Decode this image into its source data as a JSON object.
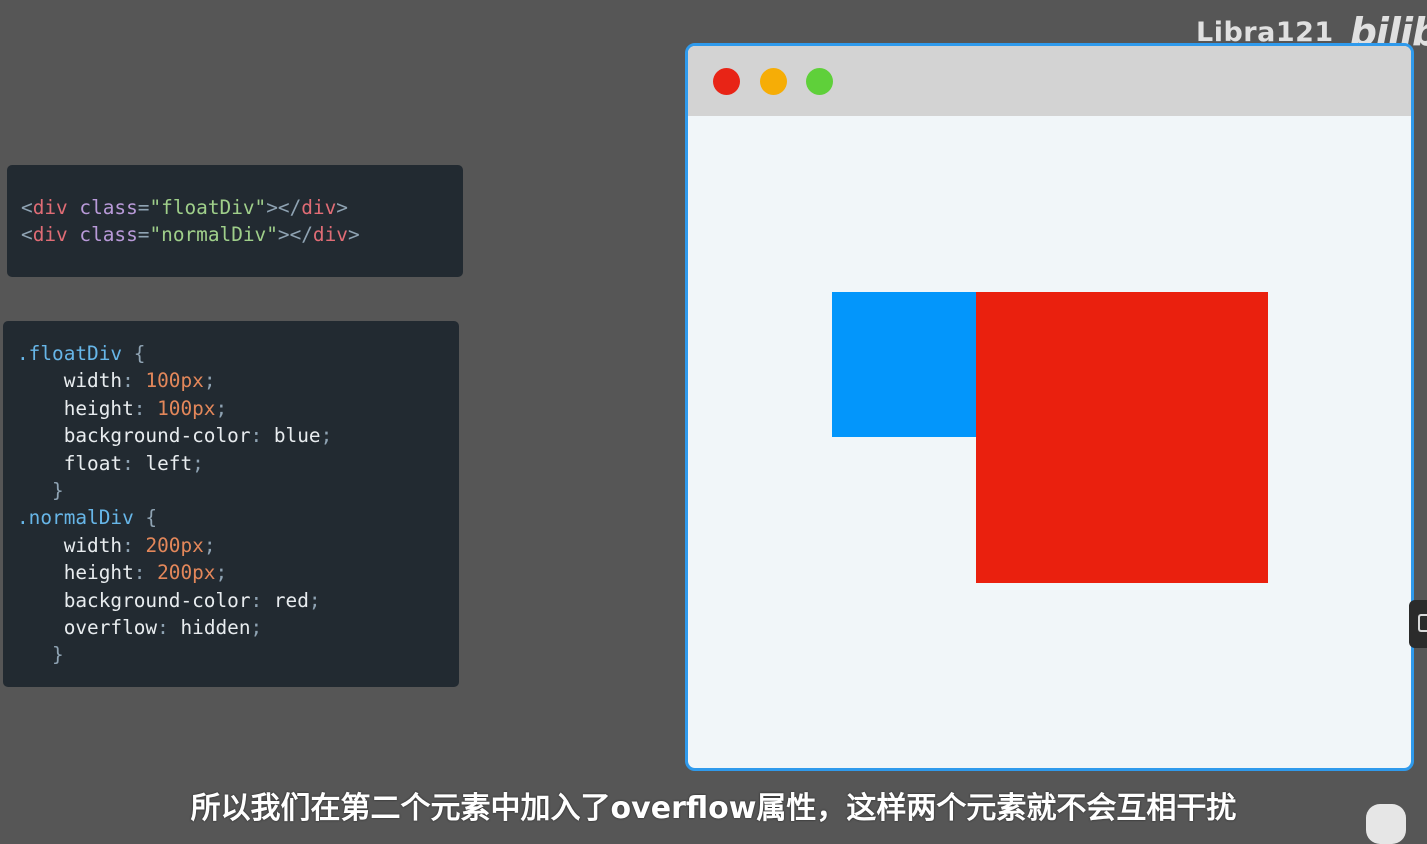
{
  "watermark": {
    "user": "Libra121",
    "logo": "bilib"
  },
  "html_code": {
    "lines": [
      [
        {
          "t": "punc",
          "v": "<"
        },
        {
          "t": "tag",
          "v": "div"
        },
        {
          "t": "punc",
          "v": " "
        },
        {
          "t": "attr",
          "v": "class"
        },
        {
          "t": "punc",
          "v": "="
        },
        {
          "t": "str",
          "v": "\"floatDiv\""
        },
        {
          "t": "punc",
          "v": "></"
        },
        {
          "t": "tag",
          "v": "div"
        },
        {
          "t": "punc",
          "v": ">"
        }
      ],
      [
        {
          "t": "punc",
          "v": "<"
        },
        {
          "t": "tag",
          "v": "div"
        },
        {
          "t": "punc",
          "v": " "
        },
        {
          "t": "attr",
          "v": "class"
        },
        {
          "t": "punc",
          "v": "="
        },
        {
          "t": "str",
          "v": "\"normalDiv\""
        },
        {
          "t": "punc",
          "v": "></"
        },
        {
          "t": "tag",
          "v": "div"
        },
        {
          "t": "punc",
          "v": ">"
        }
      ]
    ]
  },
  "css_code": {
    "lines": [
      [
        {
          "t": "sel",
          "v": ".floatDiv"
        },
        {
          "t": "punc",
          "v": " {"
        }
      ],
      [
        {
          "t": "punc",
          "v": "    "
        },
        {
          "t": "prop",
          "v": "width"
        },
        {
          "t": "punc",
          "v": ": "
        },
        {
          "t": "num",
          "v": "100px"
        },
        {
          "t": "punc",
          "v": ";"
        }
      ],
      [
        {
          "t": "punc",
          "v": "    "
        },
        {
          "t": "prop",
          "v": "height"
        },
        {
          "t": "punc",
          "v": ": "
        },
        {
          "t": "num",
          "v": "100px"
        },
        {
          "t": "punc",
          "v": ";"
        }
      ],
      [
        {
          "t": "punc",
          "v": "    "
        },
        {
          "t": "prop",
          "v": "background-color"
        },
        {
          "t": "punc",
          "v": ": "
        },
        {
          "t": "val",
          "v": "blue"
        },
        {
          "t": "punc",
          "v": ";"
        }
      ],
      [
        {
          "t": "punc",
          "v": "    "
        },
        {
          "t": "prop",
          "v": "float"
        },
        {
          "t": "punc",
          "v": ": "
        },
        {
          "t": "val",
          "v": "left"
        },
        {
          "t": "punc",
          "v": ";"
        }
      ],
      [
        {
          "t": "punc",
          "v": "   }"
        }
      ],
      [
        {
          "t": "sel",
          "v": ".normalDiv"
        },
        {
          "t": "punc",
          "v": " {"
        }
      ],
      [
        {
          "t": "punc",
          "v": "    "
        },
        {
          "t": "prop",
          "v": "width"
        },
        {
          "t": "punc",
          "v": ": "
        },
        {
          "t": "num",
          "v": "200px"
        },
        {
          "t": "punc",
          "v": ";"
        }
      ],
      [
        {
          "t": "punc",
          "v": "    "
        },
        {
          "t": "prop",
          "v": "height"
        },
        {
          "t": "punc",
          "v": ": "
        },
        {
          "t": "num",
          "v": "200px"
        },
        {
          "t": "punc",
          "v": ";"
        }
      ],
      [
        {
          "t": "punc",
          "v": "    "
        },
        {
          "t": "prop",
          "v": "background-color"
        },
        {
          "t": "punc",
          "v": ": "
        },
        {
          "t": "val",
          "v": "red"
        },
        {
          "t": "punc",
          "v": ";"
        }
      ],
      [
        {
          "t": "punc",
          "v": "    "
        },
        {
          "t": "prop",
          "v": "overflow"
        },
        {
          "t": "punc",
          "v": ": "
        },
        {
          "t": "val",
          "v": "hidden"
        },
        {
          "t": "punc",
          "v": ";"
        }
      ],
      [
        {
          "t": "punc",
          "v": "   }"
        }
      ]
    ]
  },
  "browser": {
    "dots": [
      "close-dot",
      "minimize-dot",
      "maximize-dot"
    ],
    "colors": {
      "frame": "#2f9aec",
      "titlebar": "#d3d3d3",
      "viewport": "#f1f6f9",
      "close": "#e82416",
      "minimize": "#f6ad06",
      "maximize": "#5fd03a",
      "float_div": "#0396fb",
      "normal_div": "#ea200e"
    }
  },
  "subtitle": "所以我们在第二个元素中加入了overflow属性，这样两个元素就不会互相干扰"
}
